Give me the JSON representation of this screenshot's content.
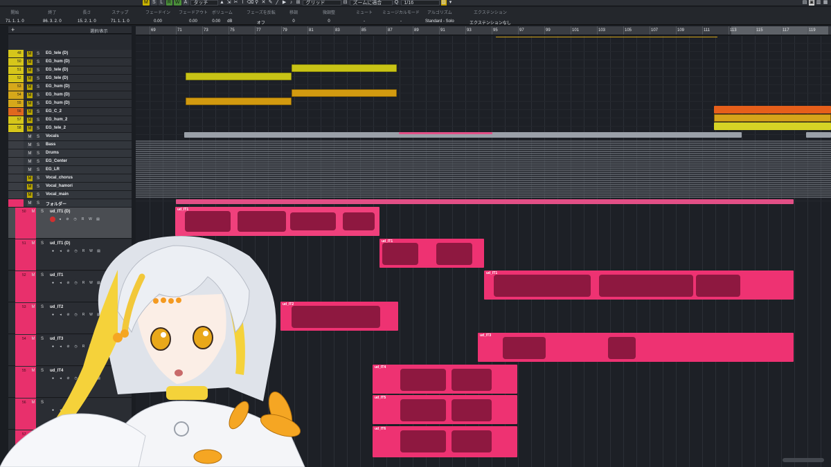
{
  "toolbar": {
    "auto_mode": "タッチ",
    "grid_type": "グリッド",
    "zoom_mode": "ズームに適合",
    "quantize": "1/16",
    "buttons": [
      "M",
      "S",
      "L",
      "R",
      "W",
      "A"
    ]
  },
  "infoline": {
    "cells": [
      {
        "label": "開始",
        "value": "71. 1. 1. 0"
      },
      {
        "label": "終了",
        "value": "86. 3. 2. 0"
      },
      {
        "label": "長さ",
        "value": "15. 2. 1. 0"
      },
      {
        "label": "スナップ",
        "value": "71. 1. 1. 0"
      },
      {
        "label": "フェードイン",
        "value": "0.00"
      },
      {
        "label": "フェードアウト",
        "value": "0.00"
      },
      {
        "label": "ボリューム",
        "value": "0.00"
      },
      {
        "label": "フェーズを反転",
        "value": "オフ"
      },
      {
        "label": "移調",
        "value": "0"
      },
      {
        "label": "微調整",
        "value": "0"
      },
      {
        "label": "ミュート",
        "value": "-"
      },
      {
        "label": "ミュージカルモード",
        "value": "-"
      },
      {
        "label": "アルゴリズム",
        "value": "Standard - Solo"
      },
      {
        "label": "エクステンション",
        "value": "エクステンションなし"
      }
    ],
    "vol_unit": "dB"
  },
  "tracklist": {
    "header_label": "選択/表示",
    "tracks": [
      {
        "num": "48",
        "name": "EG_tele (D)",
        "color": "#d6c61a"
      },
      {
        "num": "50",
        "name": "EG_hum (D)",
        "color": "#d6c61a"
      },
      {
        "num": "51",
        "name": "EG_tele (D)",
        "color": "#d6c61a"
      },
      {
        "num": "52",
        "name": "EG_tele (D)",
        "color": "#d6c61a"
      },
      {
        "num": "53",
        "name": "EG_hum (D)",
        "color": "#d6a81a"
      },
      {
        "num": "54",
        "name": "EG_hum (D)",
        "color": "#d6a81a"
      },
      {
        "num": "55",
        "name": "EG_hum (D)",
        "color": "#d6a81a"
      },
      {
        "num": "56",
        "name": "EG_C_2",
        "color": "#e0681e"
      },
      {
        "num": "57",
        "name": "EG_hum_2",
        "color": "#d6c61a"
      },
      {
        "num": "58",
        "name": "EG_tele_2",
        "color": "#d6c61a"
      }
    ],
    "folders": [
      {
        "name": "Vocals"
      },
      {
        "name": "Bass"
      },
      {
        "name": "Drums"
      },
      {
        "name": "EG_Center"
      },
      {
        "name": "EG_LR"
      },
      {
        "name": "Vocal_chorus"
      },
      {
        "name": "Vocal_hamori"
      },
      {
        "name": "Vocal_main"
      },
      {
        "name": "フォルダー"
      }
    ],
    "audio_tracks": [
      {
        "num": "50",
        "name": "ud_IT1 (D)",
        "selected": true
      },
      {
        "num": "51",
        "name": "ud_IT1 (D)",
        "selected": false
      },
      {
        "num": "52",
        "name": "ud_IT1",
        "selected": false
      },
      {
        "num": "53",
        "name": "ud_IT2",
        "selected": false
      },
      {
        "num": "54",
        "name": "ud_IT3",
        "selected": false
      },
      {
        "num": "55",
        "name": "ud_IT4",
        "selected": false
      },
      {
        "num": "56",
        "name": "",
        "selected": false
      },
      {
        "num": "57",
        "name": "",
        "selected": false
      }
    ]
  },
  "ruler": {
    "bars": [
      "69",
      "71",
      "73",
      "75",
      "77",
      "79",
      "81",
      "83",
      "85",
      "87",
      "89",
      "91",
      "93",
      "95",
      "97",
      "99",
      "101",
      "103",
      "105",
      "107",
      "109",
      "111",
      "113",
      "115",
      "117",
      "119"
    ]
  },
  "clips": {
    "audio_labels": [
      "ud_IT1",
      "ud_IT1",
      "ud_IT1",
      "ud_IT2",
      "ud_IT3",
      "ud_IT4",
      "ud_IT5",
      "ud_IT6"
    ]
  },
  "colors": {
    "accent_pink": "#ee3272",
    "mute_yellow": "#c9b400",
    "record_green": "#4a8f3a"
  }
}
